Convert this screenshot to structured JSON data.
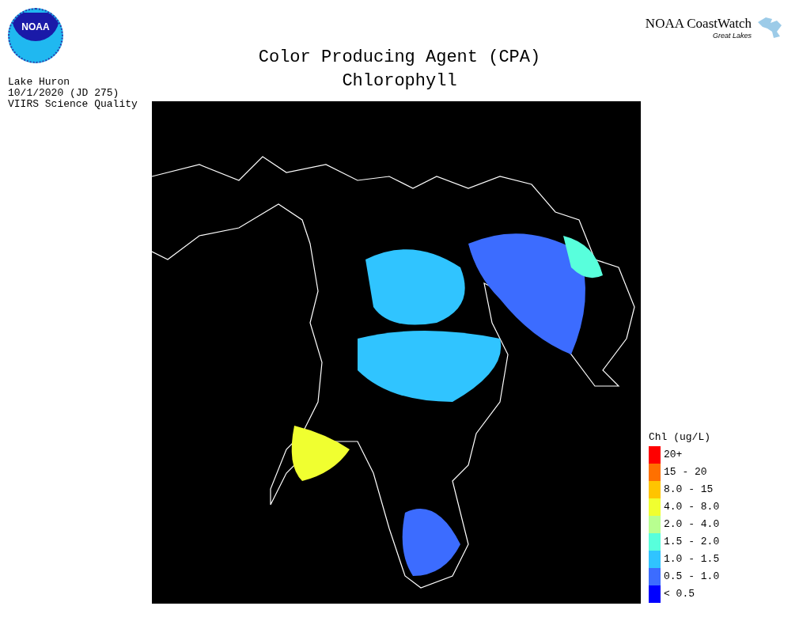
{
  "logo": {
    "text": "NOAA"
  },
  "brand": {
    "name": "NOAA CoastWatch",
    "subtitle": "Great Lakes"
  },
  "title": {
    "lines": [
      "Color Producing Agent (CPA)",
      "Chlorophyll"
    ]
  },
  "info": [
    "Lake Huron",
    "10/1/2020 (JD 275)",
    "VIIRS Science Quality"
  ],
  "legend": {
    "title": "Chl (ug/L)",
    "items": [
      {
        "label": "20+",
        "color": "#ff0000"
      },
      {
        "label": "15 - 20",
        "color": "#ff7000"
      },
      {
        "label": "8.0 - 15",
        "color": "#ffc400"
      },
      {
        "label": "4.0 - 8.0",
        "color": "#f0ff30"
      },
      {
        "label": "2.0 - 4.0",
        "color": "#b8ff90"
      },
      {
        "label": "1.5 - 2.0",
        "color": "#58ffdc"
      },
      {
        "label": "1.0 - 1.5",
        "color": "#30c4ff"
      },
      {
        "label": "0.5 - 1.0",
        "color": "#3c6cff"
      },
      {
        "label": "< 0.5",
        "color": "#0000ff"
      }
    ]
  }
}
